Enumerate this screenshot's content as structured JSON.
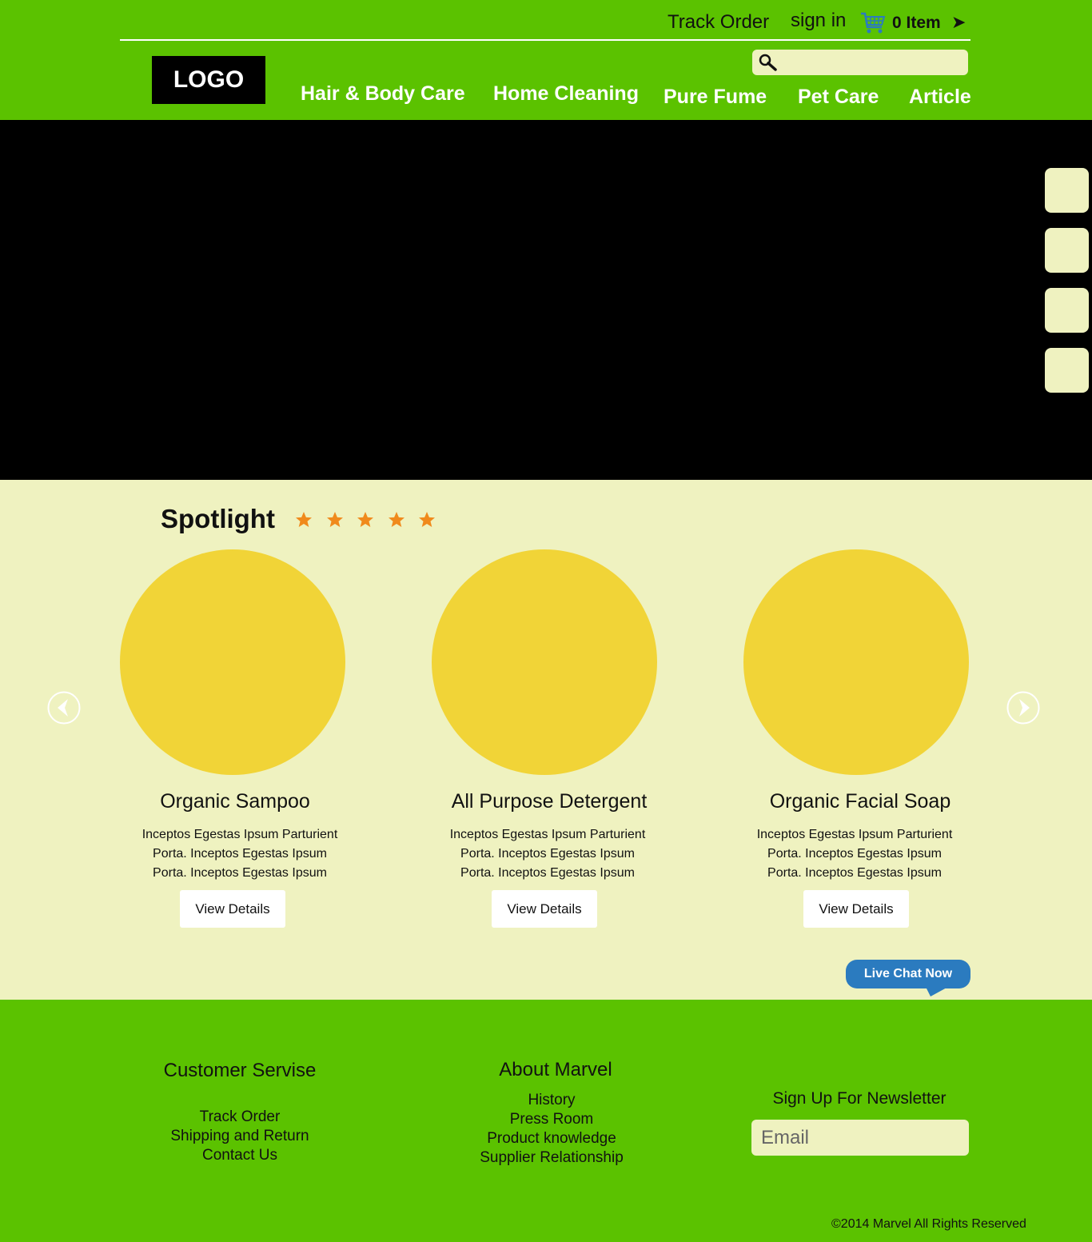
{
  "header": {
    "track_order": "Track Order",
    "sign_in": "sign in",
    "cart_count": "0 Item",
    "cart_arrow": "➤",
    "logo": "LOGO",
    "search_placeholder": "",
    "icons": {
      "cart": "shopping-cart-icon",
      "search": "search-icon"
    }
  },
  "nav": {
    "items": [
      "Hair & Body Care",
      "Home Cleaning",
      "Pure Fume",
      "Pet Care",
      "Article"
    ]
  },
  "spotlight": {
    "title": "Spotlight",
    "star_count": 5,
    "products": [
      {
        "name": "Organic Sampoo",
        "description": "Inceptos Egestas Ipsum Parturient\nPorta. Inceptos Egestas Ipsum\nPorta. Inceptos Egestas Ipsum",
        "button": "View Details"
      },
      {
        "name": "All Purpose Detergent",
        "description": "Inceptos Egestas Ipsum Parturient\nPorta. Inceptos Egestas Ipsum\nPorta. Inceptos Egestas Ipsum",
        "button": "View Details"
      },
      {
        "name": "Organic Facial Soap",
        "description": "Inceptos Egestas Ipsum Parturient\nPorta. Inceptos Egestas Ipsum\nPorta. Inceptos Egestas Ipsum",
        "button": "View Details"
      }
    ],
    "live_chat": "Live Chat Now"
  },
  "footer": {
    "customer_service": {
      "heading": "Customer Servise",
      "links": [
        "Track Order",
        "Shipping and Return",
        "Contact Us"
      ]
    },
    "about": {
      "heading": "About Marvel",
      "links": [
        "History",
        "Press Room",
        "Product knowledge",
        "Supplier Relationship"
      ]
    },
    "newsletter": {
      "heading": "Sign Up For Newsletter",
      "placeholder": "Email"
    },
    "copyright": "©2014 Marvel  All Rights Reserved"
  },
  "colors": {
    "brand_green": "#5bc200",
    "cream": "#eff2c0",
    "product_yellow": "#f1d437",
    "star_orange": "#f08a1c",
    "chat_blue": "#2b7bbf"
  }
}
